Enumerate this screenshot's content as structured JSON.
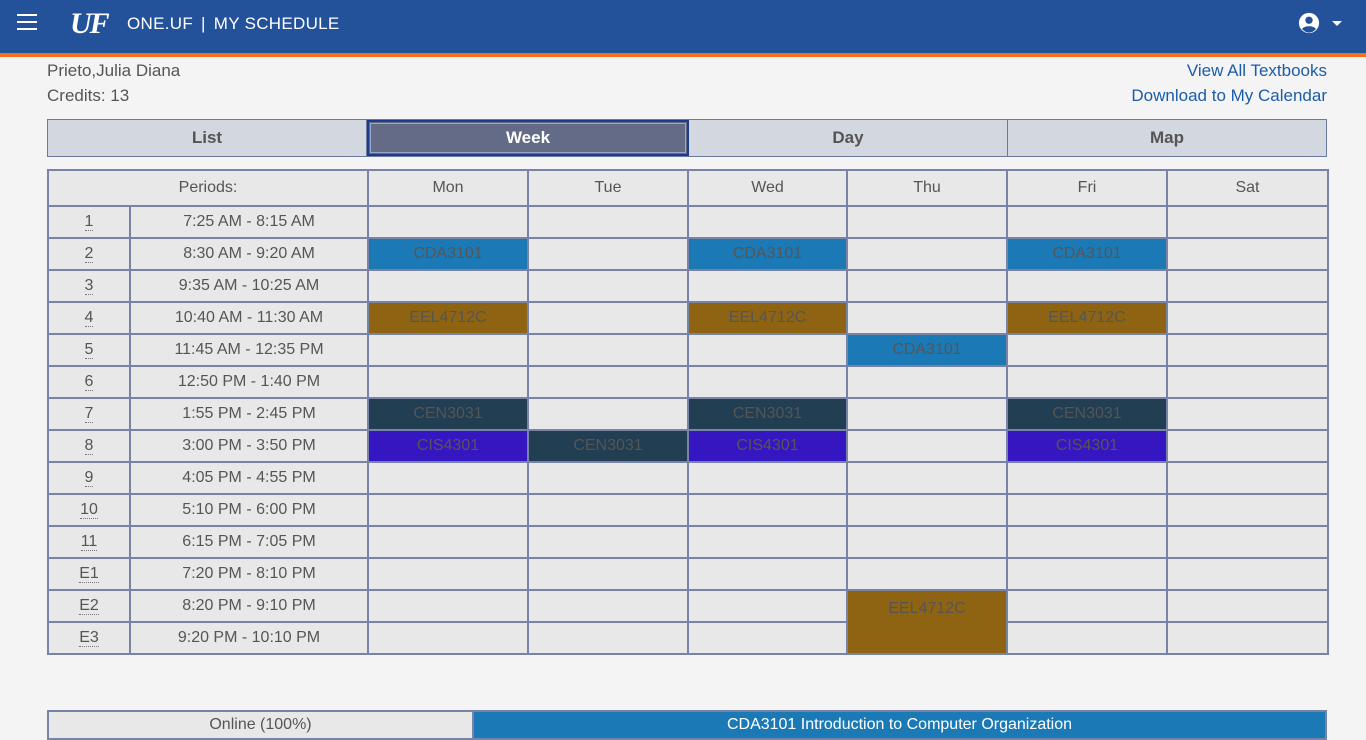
{
  "header": {
    "logo_text": "UF",
    "app_name": "ONE.UF",
    "separator": "|",
    "page_name": "MY SCHEDULE",
    "user_icon": "account-circle-icon",
    "menu_icon": "hamburger-menu-icon"
  },
  "student": {
    "name": "Prieto,Julia Diana",
    "credits": "Credits: 13"
  },
  "links": {
    "textbooks": "View All Textbooks",
    "calendar": "Download to My Calendar"
  },
  "tabs": [
    {
      "label": "List",
      "active": false
    },
    {
      "label": "Week",
      "active": true
    },
    {
      "label": "Day",
      "active": false
    },
    {
      "label": "Map",
      "active": false
    }
  ],
  "schedule": {
    "periods_header": "Periods:",
    "days": [
      "Mon",
      "Tue",
      "Wed",
      "Thu",
      "Fri",
      "Sat"
    ],
    "periods": [
      {
        "num": "1",
        "time": "7:25 AM - 8:15 AM",
        "cells": [
          "",
          "",
          "",
          "",
          "",
          ""
        ]
      },
      {
        "num": "2",
        "time": "8:30 AM - 9:20 AM",
        "cells": [
          "CDA3101",
          "",
          "CDA3101",
          "",
          "CDA3101",
          ""
        ]
      },
      {
        "num": "3",
        "time": "9:35 AM - 10:25 AM",
        "cells": [
          "",
          "",
          "",
          "",
          "",
          ""
        ]
      },
      {
        "num": "4",
        "time": "10:40 AM - 11:30 AM",
        "cells": [
          "EEL4712C",
          "",
          "EEL4712C",
          "",
          "EEL4712C",
          ""
        ]
      },
      {
        "num": "5",
        "time": "11:45 AM - 12:35 PM",
        "cells": [
          "",
          "",
          "",
          "CDA3101",
          "",
          ""
        ]
      },
      {
        "num": "6",
        "time": "12:50 PM - 1:40 PM",
        "cells": [
          "",
          "",
          "",
          "",
          "",
          ""
        ]
      },
      {
        "num": "7",
        "time": "1:55 PM - 2:45 PM",
        "cells": [
          "CEN3031",
          "",
          "CEN3031",
          "",
          "CEN3031",
          ""
        ]
      },
      {
        "num": "8",
        "time": "3:00 PM - 3:50 PM",
        "cells": [
          "CIS4301",
          "CEN3031",
          "CIS4301",
          "",
          "CIS4301",
          ""
        ]
      },
      {
        "num": "9",
        "time": "4:05 PM - 4:55 PM",
        "cells": [
          "",
          "",
          "",
          "",
          "",
          ""
        ]
      },
      {
        "num": "10",
        "time": "5:10 PM - 6:00 PM",
        "cells": [
          "",
          "",
          "",
          "",
          "",
          ""
        ]
      },
      {
        "num": "11",
        "time": "6:15 PM - 7:05 PM",
        "cells": [
          "",
          "",
          "",
          "",
          "",
          ""
        ]
      },
      {
        "num": "E1",
        "time": "7:20 PM - 8:10 PM",
        "cells": [
          "",
          "",
          "",
          "",
          "",
          ""
        ]
      },
      {
        "num": "E2",
        "time": "8:20 PM - 9:10 PM",
        "cells": [
          "",
          "",
          "",
          "EEL4712C",
          "",
          ""
        ]
      },
      {
        "num": "E3",
        "time": "9:20 PM - 10:10 PM",
        "cells": [
          "",
          "",
          "",
          "",
          "",
          ""
        ]
      }
    ]
  },
  "course_colors": {
    "CDA3101": "#1b7ab5",
    "EEL4712C": "#8e6413",
    "CEN3031": "#213e52",
    "CIS4301": "#3516c0"
  },
  "bottom": {
    "online_label": "Online (100%)",
    "course_label": "CDA3101 Introduction to Computer Organization"
  }
}
